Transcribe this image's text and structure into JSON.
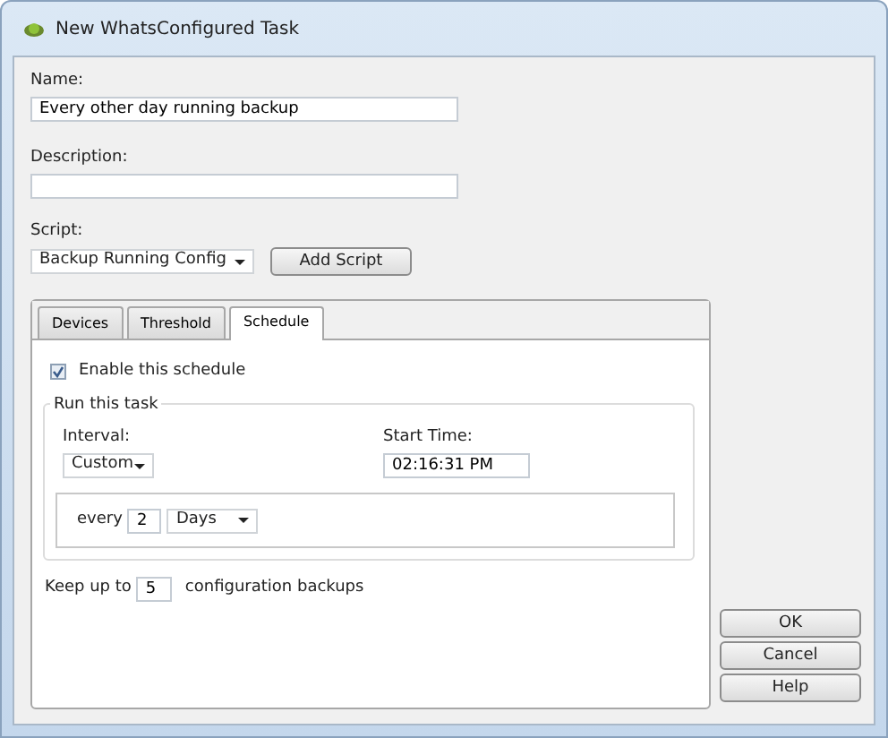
{
  "window": {
    "title": "New WhatsConfigured Task"
  },
  "name": {
    "label": "Name:",
    "value": "Every other day running backup"
  },
  "description": {
    "label": "Description:"
  },
  "script": {
    "label": "Script:",
    "value": "Backup Running Config",
    "button": "Add Script"
  },
  "tabs": [
    {
      "label": "Devices",
      "selected": false
    },
    {
      "label": "Threshold",
      "selected": false
    },
    {
      "label": "Schedule",
      "selected": true
    }
  ],
  "enable": {
    "label": "Enable this schedule",
    "checked": true
  },
  "run_group": {
    "title": "Run this task",
    "interval_label": "Interval:",
    "interval_value": "Custom",
    "start_label": "Start Time:",
    "start_value": "02:16:31 PM",
    "every_label": "every",
    "every_value": "2",
    "unit": "Days"
  },
  "keep": {
    "before": "Keep up to",
    "value": "5",
    "after": "configuration backups"
  },
  "buttons": [
    "OK",
    "Cancel",
    "Help"
  ]
}
